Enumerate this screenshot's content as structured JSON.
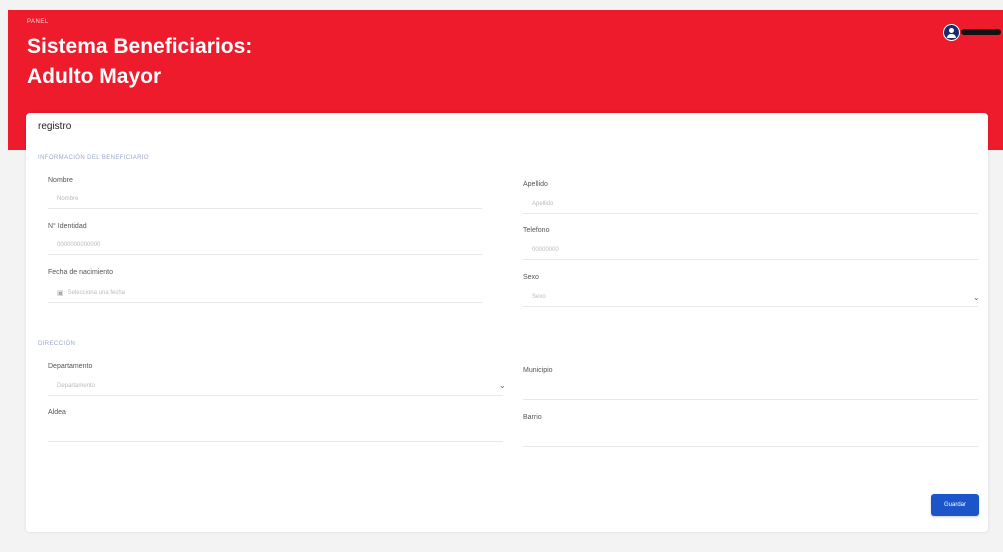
{
  "header": {
    "breadcrumb": "PANEL",
    "title": "Sistema Beneficiarios: Adulto Mayor"
  },
  "card": {
    "title": "registro",
    "sections": {
      "beneficiario": "INFORMACIÓN DEL BENEFICIARIO",
      "direccion": "DIRECCIÓN"
    },
    "fields": {
      "nombre": {
        "label": "Nombre",
        "placeholder": "Nombre"
      },
      "apellido": {
        "label": "Apellido",
        "placeholder": "Apellido"
      },
      "identidad": {
        "label": "N° Identidad",
        "placeholder": "0000000000000"
      },
      "telefono": {
        "label": "Telefono",
        "placeholder": "00000000"
      },
      "fecha": {
        "label": "Fecha de nacimiento",
        "placeholder": "Selecciona una fecha"
      },
      "sexo": {
        "label": "Sexo",
        "placeholder": "Sexo"
      },
      "departamento": {
        "label": "Departamento",
        "placeholder": "Departamento"
      },
      "municipio": {
        "label": "Municipio"
      },
      "aldea": {
        "label": "Aldea"
      },
      "barrio": {
        "label": "Barrio"
      }
    },
    "save_label": "Guardar"
  },
  "icons": {
    "avatar": "user-avatar-icon",
    "calendar": "calendar-icon",
    "chevron": "chevron-down-icon"
  },
  "colors": {
    "header_red": "#ee1b2c",
    "button_blue": "#1b55c9",
    "avatar_navy": "#1b2a6b"
  }
}
